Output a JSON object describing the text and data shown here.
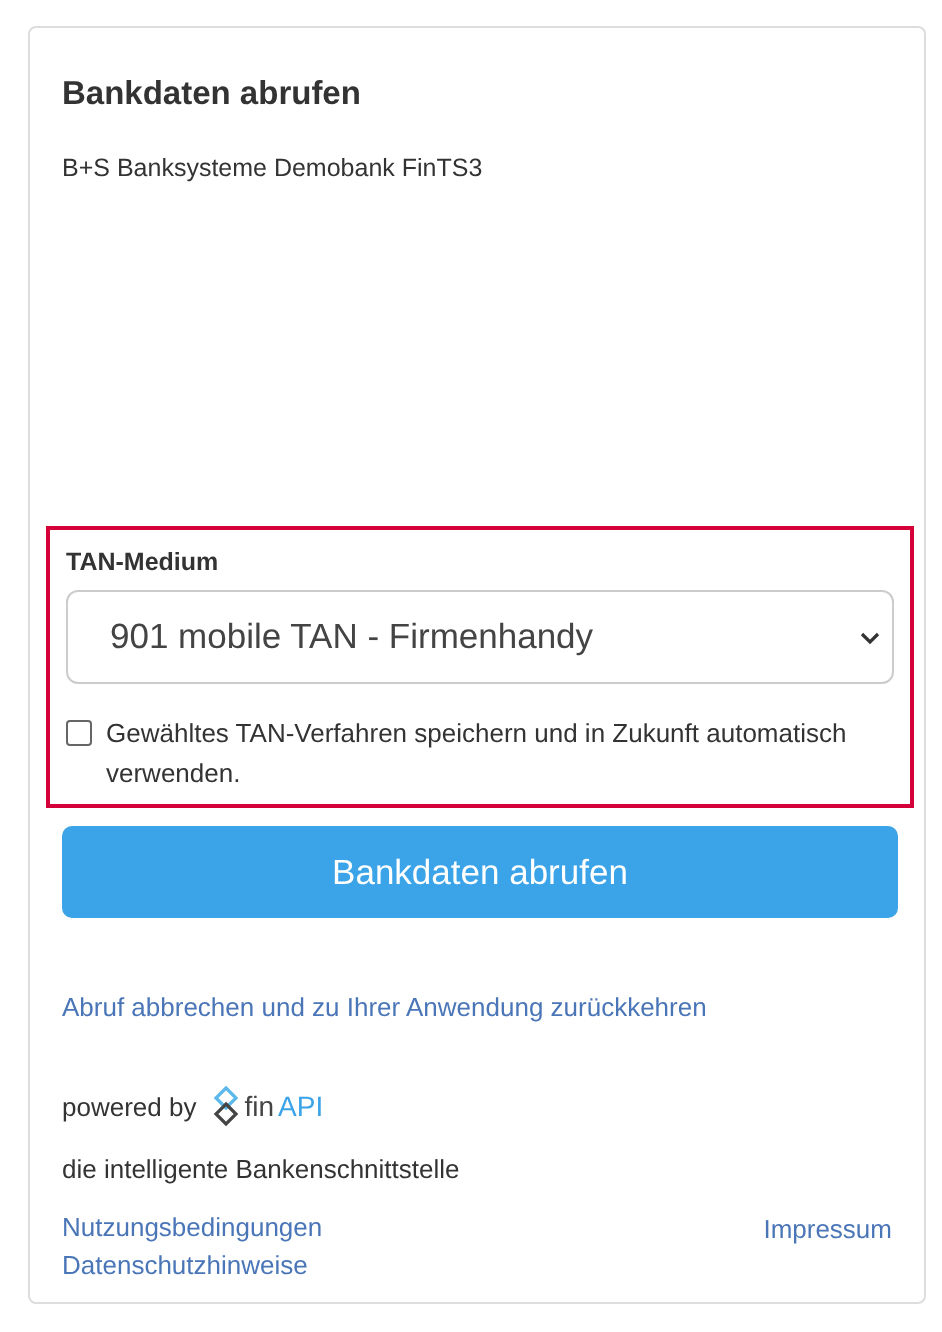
{
  "card": {
    "title": "Bankdaten abrufen",
    "bank": "B+S Banksysteme Demobank FinTS3"
  },
  "tan": {
    "label": "TAN-Medium",
    "value": "901 mobile TAN - Firmenhandy",
    "remember": {
      "label": "Gewähltes TAN-Verfahren speichern und in Zukunft automatisch verwenden.",
      "checked": false
    }
  },
  "submit": "Bankdaten abrufen",
  "cancel_link": "Abruf abbrechen und zu Ihrer Anwendung zurückkehren",
  "powered": {
    "text": "powered by",
    "logo_prefix": "fin",
    "logo_suffix": "API"
  },
  "tagline": "die intelligente Bankenschnittstelle",
  "footer": {
    "left": [
      "Nutzungsbedingungen",
      "Datenschutzhinweise"
    ],
    "right": "Impressum"
  }
}
